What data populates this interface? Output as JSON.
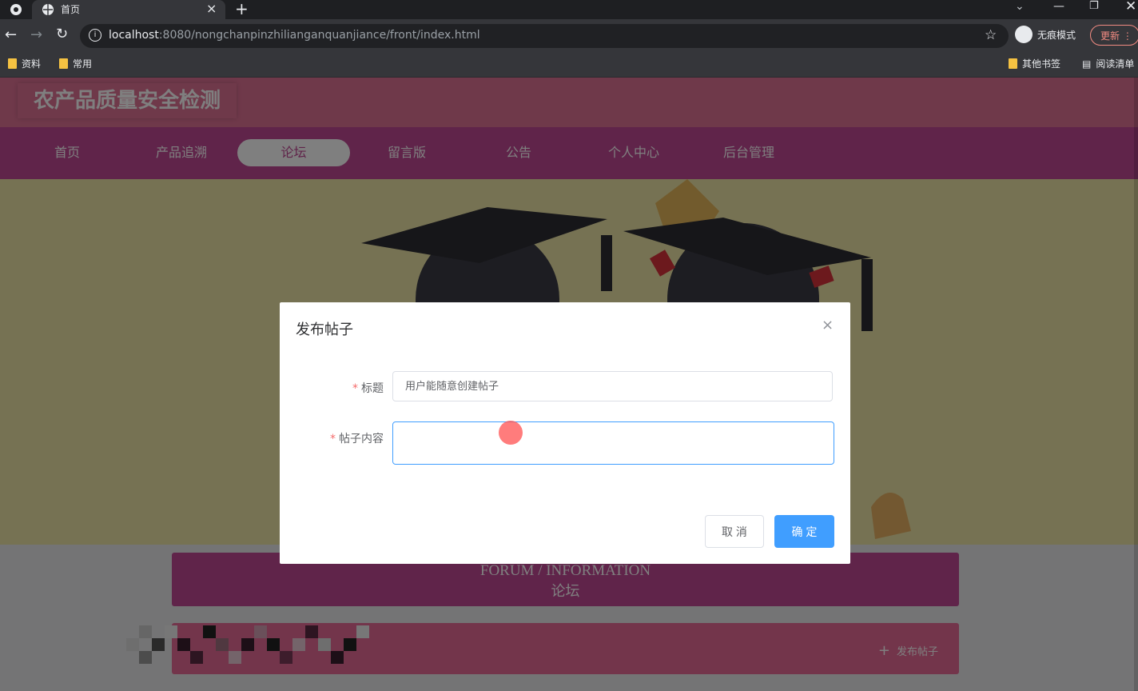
{
  "browser": {
    "tab_title": "首页",
    "url_host": "localhost",
    "url_rest": ":8080/nongchanpinzhilianganquanjiance/front/index.html",
    "incognito_label": "无痕模式",
    "update_label": "更新",
    "bookmarks": [
      "资料",
      "常用"
    ],
    "bookmarks_right": [
      "其他书签",
      "阅读清单"
    ]
  },
  "site": {
    "title": "农产品质量安全检测",
    "nav": [
      "首页",
      "产品追溯",
      "论坛",
      "留言版",
      "公告",
      "个人中心",
      "后台管理"
    ],
    "active_nav": "论坛",
    "forum_en": "FORUM / INFORMATION",
    "forum_cn": "论坛",
    "post_button": "发布帖子"
  },
  "dialog": {
    "title": "发布帖子",
    "close_symbol": "×",
    "title_label": "标题",
    "title_value": "用户能随意创建帖子",
    "content_label": "帖子内容",
    "content_value": "",
    "cancel_label": "取 消",
    "ok_label": "确 定"
  },
  "colors": {
    "header": "#df7295",
    "nav": "#c04895",
    "primary": "#409eff"
  }
}
